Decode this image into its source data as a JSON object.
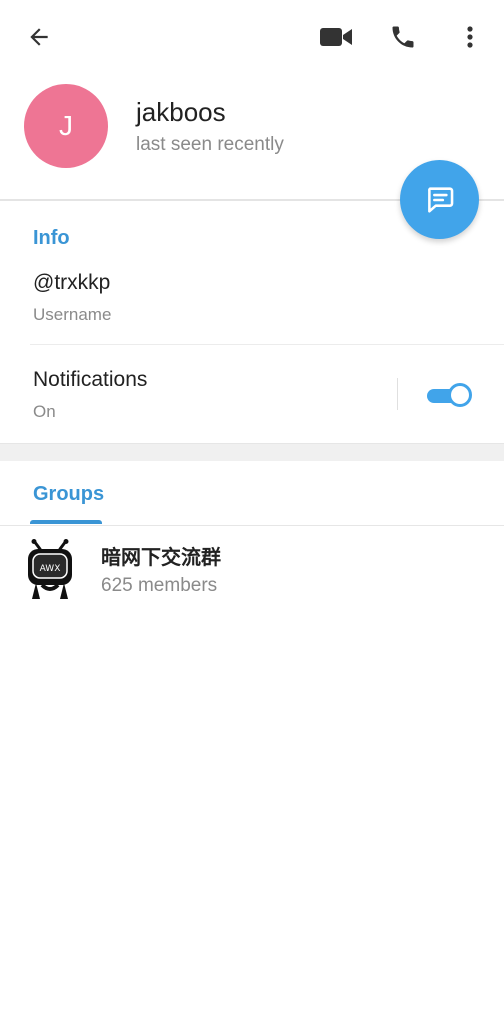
{
  "toolbar": {
    "back_icon": "arrow-left-icon",
    "video_icon": "video-camera-icon",
    "call_icon": "phone-icon",
    "menu_icon": "more-vertical-icon"
  },
  "profile": {
    "avatar_letter": "J",
    "avatar_color": "#ee7594",
    "name": "jakboos",
    "status": "last seen recently"
  },
  "fab": {
    "icon": "message-icon",
    "color": "#41a4ea"
  },
  "info": {
    "title": "Info",
    "username_value": "@trxkkp",
    "username_label": "Username",
    "notifications_label": "Notifications",
    "notifications_value": "On",
    "notifications_enabled": true
  },
  "groups": {
    "tab_label": "Groups",
    "items": [
      {
        "name": "暗网下交流群",
        "members": "625 members",
        "avatar_text": "AWX"
      }
    ]
  },
  "colors": {
    "accent": "#3a95d5",
    "secondary_text": "#8a8a8a"
  }
}
